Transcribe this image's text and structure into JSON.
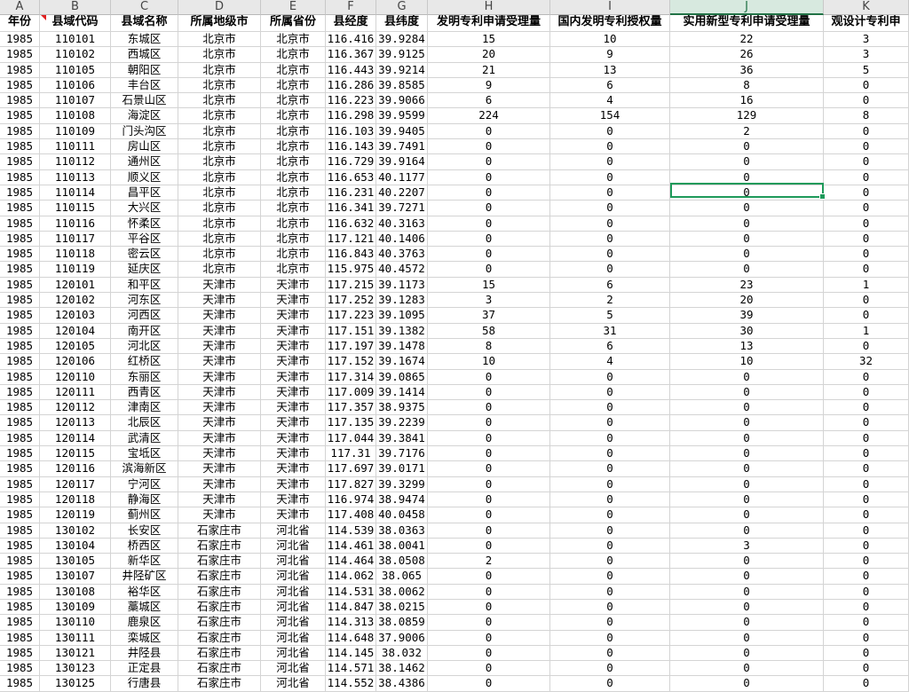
{
  "column_letters": [
    "A",
    "B",
    "C",
    "D",
    "E",
    "F",
    "G",
    "H",
    "I",
    "J",
    "K"
  ],
  "selected_column": "J",
  "headers": [
    "年份",
    "县域代码",
    "县域名称",
    "所属地级市",
    "所属省份",
    "县经度",
    "县纬度",
    "发明专利申请受理量",
    "国内发明专利授权量",
    "实用新型专利申请受理量",
    "观设计专利申"
  ],
  "rows": [
    [
      "1985",
      "110101",
      "东城区",
      "北京市",
      "北京市",
      "116.416",
      "39.9284",
      "15",
      "10",
      "22",
      "3"
    ],
    [
      "1985",
      "110102",
      "西城区",
      "北京市",
      "北京市",
      "116.367",
      "39.9125",
      "20",
      "9",
      "26",
      "3"
    ],
    [
      "1985",
      "110105",
      "朝阳区",
      "北京市",
      "北京市",
      "116.443",
      "39.9214",
      "21",
      "13",
      "36",
      "5"
    ],
    [
      "1985",
      "110106",
      "丰台区",
      "北京市",
      "北京市",
      "116.286",
      "39.8585",
      "9",
      "6",
      "8",
      "0"
    ],
    [
      "1985",
      "110107",
      "石景山区",
      "北京市",
      "北京市",
      "116.223",
      "39.9066",
      "6",
      "4",
      "16",
      "0"
    ],
    [
      "1985",
      "110108",
      "海淀区",
      "北京市",
      "北京市",
      "116.298",
      "39.9599",
      "224",
      "154",
      "129",
      "8"
    ],
    [
      "1985",
      "110109",
      "门头沟区",
      "北京市",
      "北京市",
      "116.103",
      "39.9405",
      "0",
      "0",
      "2",
      "0"
    ],
    [
      "1985",
      "110111",
      "房山区",
      "北京市",
      "北京市",
      "116.143",
      "39.7491",
      "0",
      "0",
      "0",
      "0"
    ],
    [
      "1985",
      "110112",
      "通州区",
      "北京市",
      "北京市",
      "116.729",
      "39.9164",
      "0",
      "0",
      "0",
      "0"
    ],
    [
      "1985",
      "110113",
      "顺义区",
      "北京市",
      "北京市",
      "116.653",
      "40.1177",
      "0",
      "0",
      "0",
      "0"
    ],
    [
      "1985",
      "110114",
      "昌平区",
      "北京市",
      "北京市",
      "116.231",
      "40.2207",
      "0",
      "0",
      "0",
      "0"
    ],
    [
      "1985",
      "110115",
      "大兴区",
      "北京市",
      "北京市",
      "116.341",
      "39.7271",
      "0",
      "0",
      "0",
      "0"
    ],
    [
      "1985",
      "110116",
      "怀柔区",
      "北京市",
      "北京市",
      "116.632",
      "40.3163",
      "0",
      "0",
      "0",
      "0"
    ],
    [
      "1985",
      "110117",
      "平谷区",
      "北京市",
      "北京市",
      "117.121",
      "40.1406",
      "0",
      "0",
      "0",
      "0"
    ],
    [
      "1985",
      "110118",
      "密云区",
      "北京市",
      "北京市",
      "116.843",
      "40.3763",
      "0",
      "0",
      "0",
      "0"
    ],
    [
      "1985",
      "110119",
      "延庆区",
      "北京市",
      "北京市",
      "115.975",
      "40.4572",
      "0",
      "0",
      "0",
      "0"
    ],
    [
      "1985",
      "120101",
      "和平区",
      "天津市",
      "天津市",
      "117.215",
      "39.1173",
      "15",
      "6",
      "23",
      "1"
    ],
    [
      "1985",
      "120102",
      "河东区",
      "天津市",
      "天津市",
      "117.252",
      "39.1283",
      "3",
      "2",
      "20",
      "0"
    ],
    [
      "1985",
      "120103",
      "河西区",
      "天津市",
      "天津市",
      "117.223",
      "39.1095",
      "37",
      "5",
      "39",
      "0"
    ],
    [
      "1985",
      "120104",
      "南开区",
      "天津市",
      "天津市",
      "117.151",
      "39.1382",
      "58",
      "31",
      "30",
      "1"
    ],
    [
      "1985",
      "120105",
      "河北区",
      "天津市",
      "天津市",
      "117.197",
      "39.1478",
      "8",
      "6",
      "13",
      "0"
    ],
    [
      "1985",
      "120106",
      "红桥区",
      "天津市",
      "天津市",
      "117.152",
      "39.1674",
      "10",
      "4",
      "10",
      "32"
    ],
    [
      "1985",
      "120110",
      "东丽区",
      "天津市",
      "天津市",
      "117.314",
      "39.0865",
      "0",
      "0",
      "0",
      "0"
    ],
    [
      "1985",
      "120111",
      "西青区",
      "天津市",
      "天津市",
      "117.009",
      "39.1414",
      "0",
      "0",
      "0",
      "0"
    ],
    [
      "1985",
      "120112",
      "津南区",
      "天津市",
      "天津市",
      "117.357",
      "38.9375",
      "0",
      "0",
      "0",
      "0"
    ],
    [
      "1985",
      "120113",
      "北辰区",
      "天津市",
      "天津市",
      "117.135",
      "39.2239",
      "0",
      "0",
      "0",
      "0"
    ],
    [
      "1985",
      "120114",
      "武清区",
      "天津市",
      "天津市",
      "117.044",
      "39.3841",
      "0",
      "0",
      "0",
      "0"
    ],
    [
      "1985",
      "120115",
      "宝坻区",
      "天津市",
      "天津市",
      "117.31",
      "39.7176",
      "0",
      "0",
      "0",
      "0"
    ],
    [
      "1985",
      "120116",
      "滨海新区",
      "天津市",
      "天津市",
      "117.697",
      "39.0171",
      "0",
      "0",
      "0",
      "0"
    ],
    [
      "1985",
      "120117",
      "宁河区",
      "天津市",
      "天津市",
      "117.827",
      "39.3299",
      "0",
      "0",
      "0",
      "0"
    ],
    [
      "1985",
      "120118",
      "静海区",
      "天津市",
      "天津市",
      "116.974",
      "38.9474",
      "0",
      "0",
      "0",
      "0"
    ],
    [
      "1985",
      "120119",
      "蓟州区",
      "天津市",
      "天津市",
      "117.408",
      "40.0458",
      "0",
      "0",
      "0",
      "0"
    ],
    [
      "1985",
      "130102",
      "长安区",
      "石家庄市",
      "河北省",
      "114.539",
      "38.0363",
      "0",
      "0",
      "0",
      "0"
    ],
    [
      "1985",
      "130104",
      "桥西区",
      "石家庄市",
      "河北省",
      "114.461",
      "38.0041",
      "0",
      "0",
      "3",
      "0"
    ],
    [
      "1985",
      "130105",
      "新华区",
      "石家庄市",
      "河北省",
      "114.464",
      "38.0508",
      "2",
      "0",
      "0",
      "0"
    ],
    [
      "1985",
      "130107",
      "井陉矿区",
      "石家庄市",
      "河北省",
      "114.062",
      "38.065",
      "0",
      "0",
      "0",
      "0"
    ],
    [
      "1985",
      "130108",
      "裕华区",
      "石家庄市",
      "河北省",
      "114.531",
      "38.0062",
      "0",
      "0",
      "0",
      "0"
    ],
    [
      "1985",
      "130109",
      "藁城区",
      "石家庄市",
      "河北省",
      "114.847",
      "38.0215",
      "0",
      "0",
      "0",
      "0"
    ],
    [
      "1985",
      "130110",
      "鹿泉区",
      "石家庄市",
      "河北省",
      "114.313",
      "38.0859",
      "0",
      "0",
      "0",
      "0"
    ],
    [
      "1985",
      "130111",
      "栾城区",
      "石家庄市",
      "河北省",
      "114.648",
      "37.9006",
      "0",
      "0",
      "0",
      "0"
    ],
    [
      "1985",
      "130121",
      "井陉县",
      "石家庄市",
      "河北省",
      "114.145",
      "38.032",
      "0",
      "0",
      "0",
      "0"
    ],
    [
      "1985",
      "130123",
      "正定县",
      "石家庄市",
      "河北省",
      "114.571",
      "38.1462",
      "0",
      "0",
      "0",
      "0"
    ],
    [
      "1985",
      "130125",
      "行唐县",
      "石家庄市",
      "河北省",
      "114.552",
      "38.4386",
      "0",
      "0",
      "0",
      "0"
    ]
  ]
}
